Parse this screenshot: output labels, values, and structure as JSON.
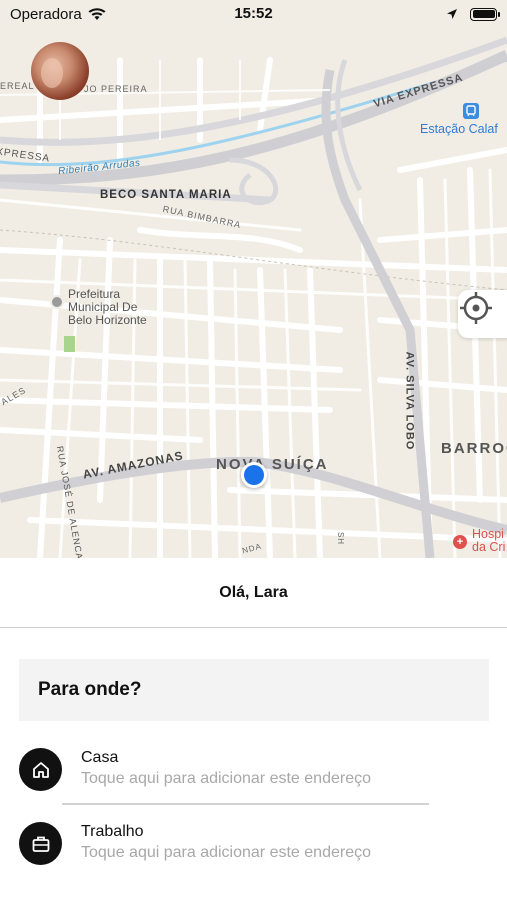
{
  "status_bar": {
    "carrier": "Operadora",
    "time": "15:52",
    "icons": [
      "wifi-icon",
      "location-arrow-icon",
      "battery-icon"
    ]
  },
  "map": {
    "labels": {
      "beco": "BECO SANTA MARIA",
      "bimbarra": "RUA BIMBARRA",
      "amazonas": "AV. AMAZONAS",
      "nova_suica": "NOVA SUÍÇA",
      "barroca": "BARROC",
      "silva_lobo": "AV. SILVA LOBO",
      "ribeirao": "Ribeirão Arrudas",
      "via_expressa": "VIA EXPRESSA",
      "expressa_left": "XPRESSA",
      "ereal": "EREAL",
      "pereira": "JO PEREIRA",
      "jose": "RUA JOSÉ DE ALENCA",
      "ales": "ALES",
      "prefeitura": "Prefeitura\nMunicipal De\nBelo Horizonte",
      "estacao": "Estação Calaf",
      "hospital": "Hospi\nda Cri",
      "nda": "NDA",
      "sh": "SH"
    },
    "accent_colors": {
      "user_location": "#1a73e8",
      "metro": "#3a8de0",
      "hospital": "#e0504d",
      "river": "#2d7fb8"
    }
  },
  "greeting": "Olá, Lara",
  "search": {
    "prompt": "Para onde?"
  },
  "places": [
    {
      "title": "Casa",
      "subtitle": "Toque aqui para adicionar este endereço",
      "icon": "home-icon"
    },
    {
      "title": "Trabalho",
      "subtitle": "Toque aqui para adicionar este endereço",
      "icon": "briefcase-icon"
    }
  ]
}
